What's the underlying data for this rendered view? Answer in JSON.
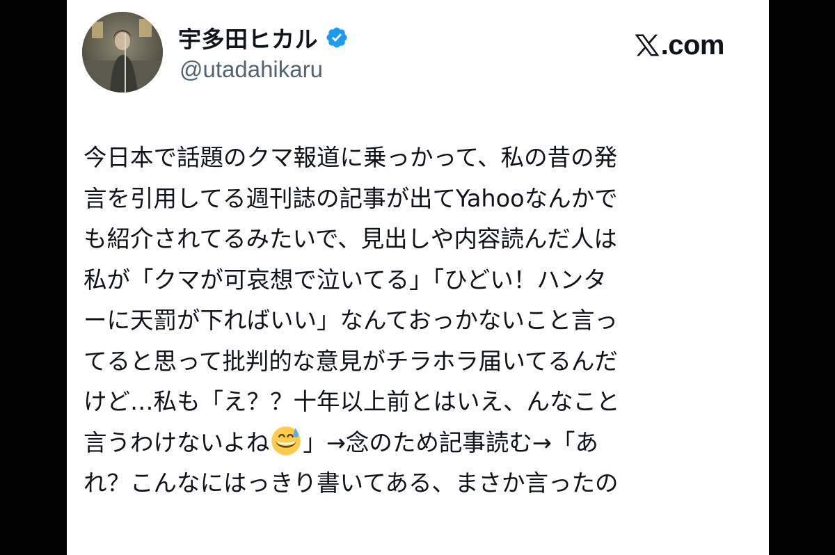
{
  "profile": {
    "display_name": "宇多田ヒカル",
    "handle": "@utadahikaru",
    "verified_icon": "verified-badge-icon"
  },
  "site": {
    "label": ".com",
    "logo_icon": "x-logo-icon"
  },
  "tweet": {
    "lines": [
      "今日本で話題のクマ報道に乗っかって、私の昔の発",
      "言を引用してる週刊誌の記事が出てYahooなんかで",
      "も紹介されてるみたいで、見出しや内容読んだ人は",
      "私が「クマが可哀想で泣いてる」「ひどい！ハンタ",
      "ーに天罰が下ればいい」なんておっかないこと言っ",
      "てると思って批判的な意見がチラホラ届いてるんだ",
      "けど…私も「え？？十年以上前とはいえ、んなこと",
      "言うわけないよね",
      "」→念のため記事読む→「あ",
      "れ？こんなにはっきり書いてある、まさか言ったの"
    ],
    "emoji_icon": "grinning-sweat-emoji-icon"
  },
  "colors": {
    "background": "#000000",
    "card": "#ffffff",
    "text": "#0f1419",
    "handle": "#536471",
    "verified": "#1d9bf0"
  }
}
